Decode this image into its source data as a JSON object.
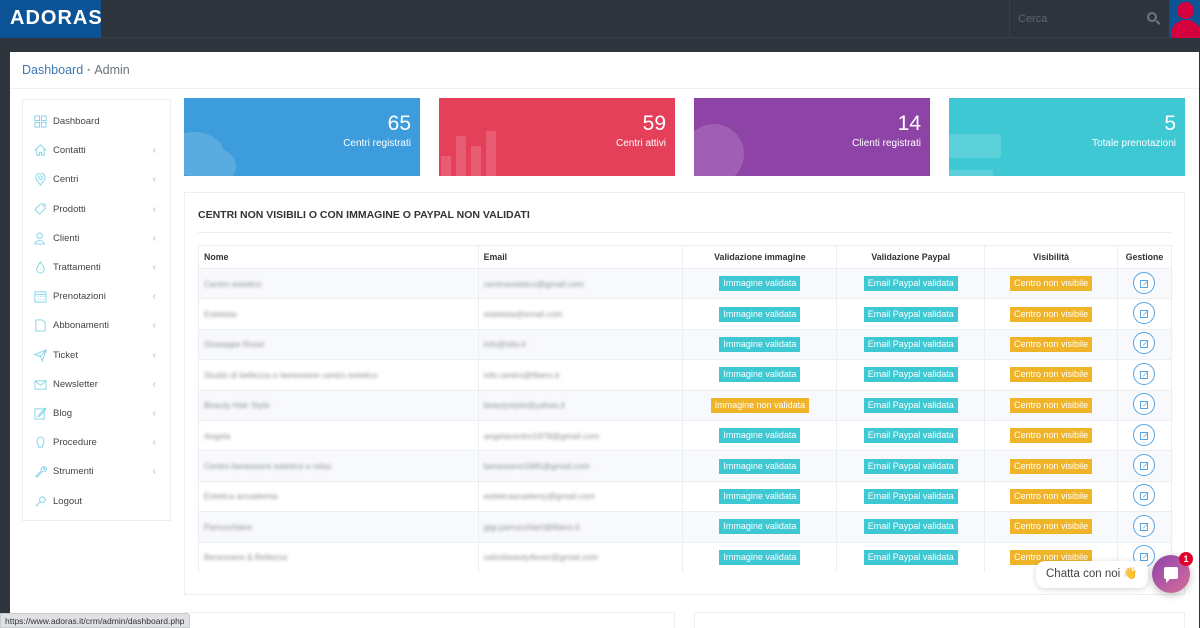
{
  "app": {
    "logo": "ADORAS"
  },
  "topbar": {
    "search_placeholder": "Cerca"
  },
  "breadcrumb": {
    "link": "Dashboard",
    "separator": "•",
    "current": "Admin"
  },
  "sidebar": {
    "items": [
      {
        "label": "Dashboard",
        "icon": "grid-icon",
        "has_submenu": false
      },
      {
        "label": "Contatti",
        "icon": "home-icon",
        "has_submenu": true
      },
      {
        "label": "Centri",
        "icon": "map-pin-icon",
        "has_submenu": true
      },
      {
        "label": "Prodotti",
        "icon": "tag-icon",
        "has_submenu": true
      },
      {
        "label": "Clienti",
        "icon": "users-icon",
        "has_submenu": true
      },
      {
        "label": "Trattamenti",
        "icon": "drop-icon",
        "has_submenu": true
      },
      {
        "label": "Prenotazioni",
        "icon": "calendar-icon",
        "has_submenu": true
      },
      {
        "label": "Abbonamenti",
        "icon": "document-icon",
        "has_submenu": true
      },
      {
        "label": "Ticket",
        "icon": "paper-plane-icon",
        "has_submenu": true
      },
      {
        "label": "Newsletter",
        "icon": "envelope-icon",
        "has_submenu": true
      },
      {
        "label": "Blog",
        "icon": "edit-icon",
        "has_submenu": true
      },
      {
        "label": "Procedure",
        "icon": "lightbulb-icon",
        "has_submenu": true
      },
      {
        "label": "Strumenti",
        "icon": "wrench-icon",
        "has_submenu": true
      },
      {
        "label": "Logout",
        "icon": "key-icon",
        "has_submenu": false
      }
    ],
    "chevron": "‹"
  },
  "stats": [
    {
      "value": "65",
      "label": "Centri registrati",
      "color": "#3d9cdb"
    },
    {
      "value": "59",
      "label": "Centri attivi",
      "color": "#e4405a"
    },
    {
      "value": "14",
      "label": "Clienti registrati",
      "color": "#8e44a7"
    },
    {
      "value": "5",
      "label": "Totale prenotazioni",
      "color": "#3ec8d3"
    }
  ],
  "panel": {
    "title": "CENTRI NON VISIBILI O CON IMMAGINE O PAYPAL NON VALIDATI",
    "columns": [
      "Nome",
      "Email",
      "Validazione immagine",
      "Validazione Paypal",
      "Visibilità",
      "Gestione"
    ],
    "rows": [
      {
        "nome": "Centro estetico",
        "email": "centroestetico@gmail.com",
        "immagine": "Immagine validata",
        "paypal": "Email Paypal validata",
        "visibilita": "Centro non visibile"
      },
      {
        "nome": "Estetista",
        "email": "estetista@email.com",
        "immagine": "Immagine validata",
        "paypal": "Email Paypal validata",
        "visibilita": "Centro non visibile"
      },
      {
        "nome": "Giuseppe Rossi",
        "email": "info@sito.it",
        "immagine": "Immagine validata",
        "paypal": "Email Paypal validata",
        "visibilita": "Centro non visibile"
      },
      {
        "nome": "Studio di bellezza e benessere centro estetico",
        "email": "info.centro@libero.it",
        "immagine": "Immagine validata",
        "paypal": "Email Paypal validata",
        "visibilita": "Centro non visibile"
      },
      {
        "nome": "Beauty Hair Style",
        "email": "beautystyle@yahoo.it",
        "immagine": "Immagine non validata",
        "paypal": "Email Paypal validata",
        "visibilita": "Centro non visibile"
      },
      {
        "nome": "Angela",
        "email": "angelacentro1978@gmail.com",
        "immagine": "Immagine validata",
        "paypal": "Email Paypal validata",
        "visibilita": "Centro non visibile"
      },
      {
        "nome": "Centro benessere estetica e relax",
        "email": "benessere1985@gmail.com",
        "immagine": "Immagine validata",
        "paypal": "Email Paypal validata",
        "visibilita": "Centro non visibile"
      },
      {
        "nome": "Estetica accademia",
        "email": "esteticaacademy@gmail.com",
        "immagine": "Immagine validata",
        "paypal": "Email Paypal validata",
        "visibilita": "Centro non visibile"
      },
      {
        "nome": "Parrucchiere",
        "email": "gigi.parrucchieri@libero.it",
        "immagine": "Immagine validata",
        "paypal": "Email Paypal validata",
        "visibilita": "Centro non visibile"
      },
      {
        "nome": "Benessere & Bellezza",
        "email": "salonbeauty4ever@gmail.com",
        "immagine": "Immagine validata",
        "paypal": "Email Paypal validata",
        "visibilita": "Centro non visibile"
      }
    ],
    "badge_colors": {
      "validated": "#3ec8d3",
      "warning": "#f0b429"
    }
  },
  "status_url": "https://www.adoras.it/crm/admin/dashboard.php",
  "chat": {
    "label": "Chatta con noi",
    "emoji": "👋",
    "unread": "1"
  }
}
